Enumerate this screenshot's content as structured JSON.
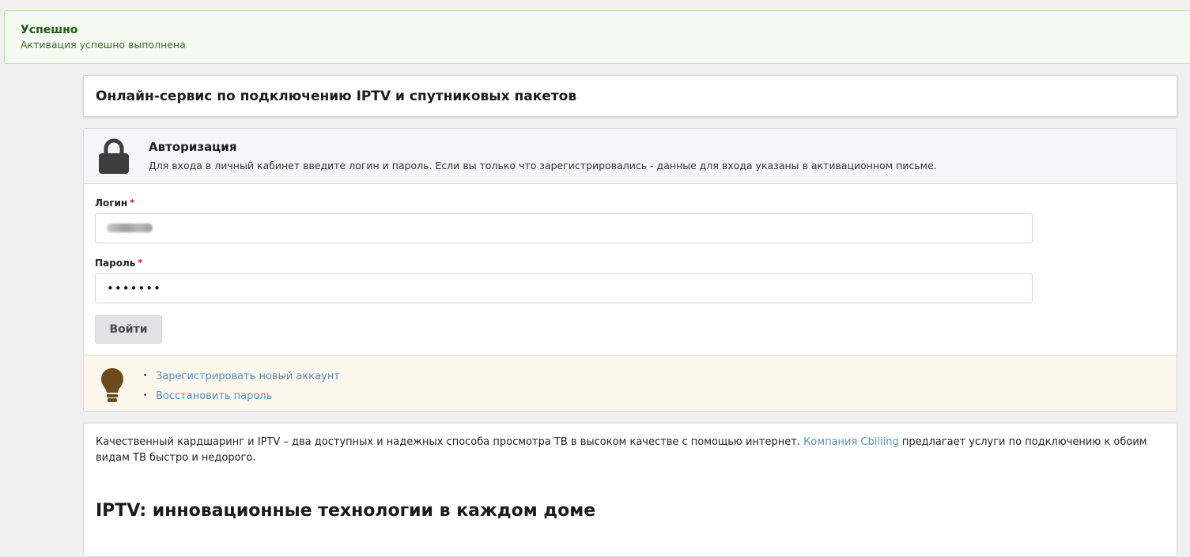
{
  "alert": {
    "title": "Успешно",
    "text": "Активация успешно выполнена"
  },
  "page": {
    "title": "Онлайн-сервис по подключению IPTV и спутниковых пакетов"
  },
  "auth": {
    "title": "Авторизация",
    "description": "Для входа в личный кабинет введите логин и пароль. Если вы только что зарегистрировались - данные для входа указаны в активационном письме.",
    "login_label": "Логин",
    "password_label": "Пароль",
    "required_mark": "*",
    "password_value": "•••••••",
    "submit_label": "Войти",
    "icon": "lock-icon"
  },
  "hints": {
    "icon": "lightbulb-icon",
    "links": [
      "Зарегистрировать новый аккаунт",
      "Восстановить пароль"
    ]
  },
  "content": {
    "intro_before": "Качественный кардшаринг и IPTV – два доступных и надежных способа просмотра ТВ в высоком качестве с помощью интернет. ",
    "intro_link": "Компания Cbilling",
    "intro_after": " предлагает услуги по подключению к обоим видам ТВ быстро и недорого.",
    "heading": "IPTV: инновационные технологии в каждом доме"
  },
  "colors": {
    "success_title": "#1f5c14",
    "link": "#5a8fbf",
    "required": "#d0021b",
    "icon_dark": "#3d3d3d",
    "bulb": "#6b4a1e"
  }
}
